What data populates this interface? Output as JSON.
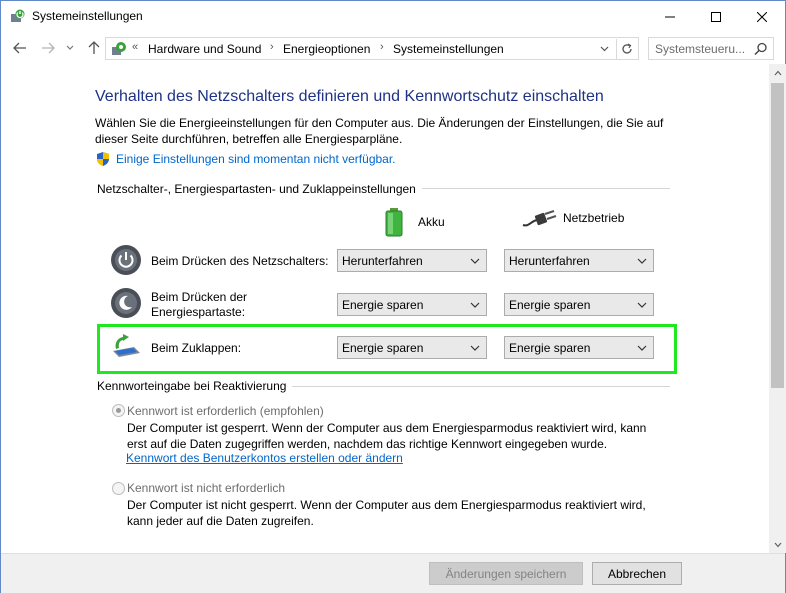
{
  "window": {
    "title": "Systemeinstellungen",
    "icon": "power-options-icon"
  },
  "address": {
    "crumbs": [
      "Hardware und Sound",
      "Energieoptionen",
      "Systemeinstellungen"
    ],
    "search_placeholder": "Systemsteueru..."
  },
  "page": {
    "heading": "Verhalten des Netzschalters definieren und Kennwortschutz einschalten",
    "description": "Wählen Sie die Energieeinstellungen für den Computer aus. Die Änderungen der Einstellungen, die Sie auf dieser Seite durchführen, betreffen alle Energiesparpläne.",
    "change_link": "Einige Einstellungen sind momentan nicht verfügbar."
  },
  "buttons_section": {
    "title": "Netzschalter-, Energiespartasten- und Zuklappeinstellungen",
    "col_battery": "Akku",
    "col_plugged": "Netzbetrieb",
    "rows": [
      {
        "label": "Beim Drücken des Netzschalters:",
        "battery": "Herunterfahren",
        "plugged": "Herunterfahren"
      },
      {
        "label": "Beim Drücken der Energiespartaste:",
        "battery": "Energie sparen",
        "plugged": "Energie sparen"
      },
      {
        "label": "Beim Zuklappen:",
        "battery": "Energie sparen",
        "plugged": "Energie sparen"
      }
    ]
  },
  "password_section": {
    "title": "Kennworteingabe bei Reaktivierung",
    "option_required": "Kennwort ist erforderlich (empfohlen)",
    "option_required_desc": "Der Computer ist gesperrt. Wenn der Computer aus dem Energiesparmodus reaktiviert wird, kann erst auf die Daten zugegriffen werden, nachdem das richtige Kennwort eingegeben wurde.",
    "create_password_link": "Kennwort des Benutzerkontos erstellen oder ändern",
    "option_not_required": "Kennwort ist nicht erforderlich",
    "option_not_required_desc": "Der Computer ist nicht gesperrt. Wenn der Computer aus dem Energiesparmodus reaktiviert wird, kann jeder auf die Daten zugreifen."
  },
  "footer": {
    "save_label": "Änderungen speichern",
    "cancel_label": "Abbrechen"
  },
  "colors": {
    "heading": "#1e3287",
    "link": "#0066cc",
    "highlight": "#1ee81e"
  }
}
